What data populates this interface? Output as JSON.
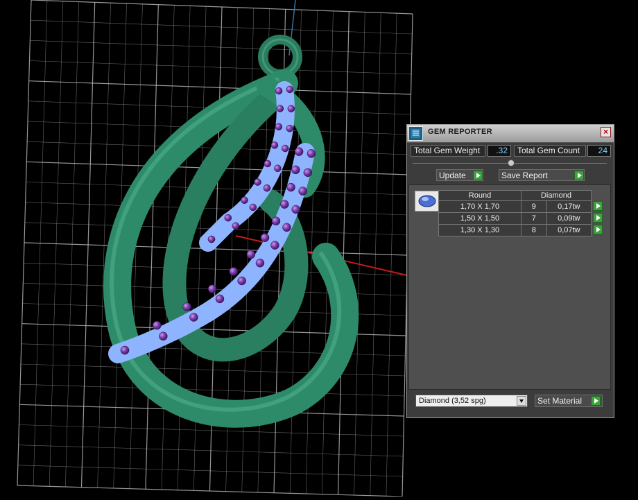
{
  "panel": {
    "title": "GEM REPORTER",
    "close_glyph": "×",
    "total_weight_label": "Total Gem Weight",
    "total_weight_value": ".32",
    "total_count_label": "Total Gem Count",
    "total_count_value": "24",
    "update_label": "Update",
    "save_report_label": "Save Report",
    "table": {
      "headers": [
        "Round",
        "Diamond"
      ],
      "rows": [
        {
          "size": "1,70 X 1,70",
          "count": "9",
          "weight": "0,17tw"
        },
        {
          "size": "1,50 X 1,50",
          "count": "7",
          "weight": "0,09tw"
        },
        {
          "size": "1,30 X 1,30",
          "count": "8",
          "weight": "0,07tw"
        }
      ]
    },
    "material_value": "Diamond     (3,52 spg)",
    "set_material_label": "Set Material"
  },
  "icons": {
    "app": "gem-reporter-icon",
    "gem": "round-gem-icon",
    "action": "play-arrow-icon"
  },
  "colors": {
    "pendant": "#2e8b6a",
    "gem_stone": "#7a3ca8",
    "gem_seat": "#8fb4ff",
    "grid": "#c8c8c8",
    "axis_x": "#c41a1a",
    "axis_y": "#3a6f9a"
  }
}
